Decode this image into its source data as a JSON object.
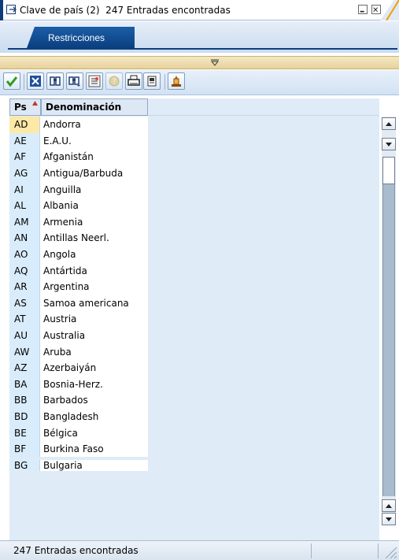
{
  "window": {
    "title": "Clave de país (2)  247 Entradas encontradas"
  },
  "tabs": [
    {
      "label": "Restricciones"
    }
  ],
  "table": {
    "columns": [
      {
        "label": "Ps",
        "sorted": "ascending"
      },
      {
        "label": "Denominación"
      }
    ],
    "selected_row": 0,
    "rows": [
      {
        "code": "AD",
        "name": "Andorra"
      },
      {
        "code": "AE",
        "name": "E.A.U."
      },
      {
        "code": "AF",
        "name": "Afganistán"
      },
      {
        "code": "AG",
        "name": "Antigua/Barbuda"
      },
      {
        "code": "AI",
        "name": "Anguilla"
      },
      {
        "code": "AL",
        "name": "Albania"
      },
      {
        "code": "AM",
        "name": "Armenia"
      },
      {
        "code": "AN",
        "name": "Antillas Neerl."
      },
      {
        "code": "AO",
        "name": "Angola"
      },
      {
        "code": "AQ",
        "name": "Antártida"
      },
      {
        "code": "AR",
        "name": "Argentina"
      },
      {
        "code": "AS",
        "name": "Samoa americana"
      },
      {
        "code": "AT",
        "name": "Austria"
      },
      {
        "code": "AU",
        "name": "Australia"
      },
      {
        "code": "AW",
        "name": "Aruba"
      },
      {
        "code": "AZ",
        "name": "Azerbaiyán"
      },
      {
        "code": "BA",
        "name": "Bosnia-Herz."
      },
      {
        "code": "BB",
        "name": "Barbados"
      },
      {
        "code": "BD",
        "name": "Bangladesh"
      },
      {
        "code": "BE",
        "name": "Bélgica"
      },
      {
        "code": "BF",
        "name": "Burkina Faso"
      },
      {
        "code": "BG",
        "name": "Bulgaria"
      }
    ]
  },
  "toolbar": {
    "buttons": [
      {
        "icon": "check-icon"
      },
      {
        "icon": "cancel-icon"
      },
      {
        "icon": "find-icon"
      },
      {
        "icon": "find-next-icon"
      },
      {
        "icon": "multiple-selection-icon"
      },
      {
        "icon": "info-icon",
        "disabled": true
      },
      {
        "icon": "print-icon"
      },
      {
        "icon": "copy-icon"
      },
      {
        "icon": "personal-list-icon"
      }
    ]
  },
  "status": {
    "text": "247 Entradas encontradas"
  },
  "colors": {
    "tab_active": "#0b3f7f",
    "code_column": "#d9ecfb",
    "selected_code": "#fde9a6",
    "collapse_bar": "#e7d29a",
    "check_green": "#2f9a1f",
    "cancel_blue": "#1f4fa0"
  }
}
